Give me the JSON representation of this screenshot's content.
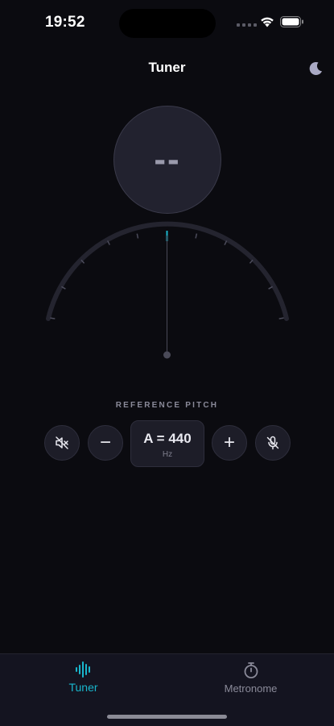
{
  "status_bar": {
    "time": "19:52"
  },
  "header": {
    "title": "Tuner",
    "theme_icon": "moon-icon"
  },
  "note_display": {
    "note": "--"
  },
  "gauge": {
    "needle_position": 0,
    "accent_color": "#19b6cc"
  },
  "reference": {
    "label": "REFERENCE PITCH",
    "value": "A = 440",
    "unit": "Hz",
    "minus_symbol": "−",
    "plus_symbol": "+"
  },
  "tabs": [
    {
      "label": "Tuner",
      "icon": "waveform-icon",
      "active": true
    },
    {
      "label": "Metronome",
      "icon": "stopwatch-icon",
      "active": false
    }
  ],
  "colors": {
    "accent": "#19b6cc",
    "background": "#0b0b10",
    "surface": "#1d1d28"
  }
}
